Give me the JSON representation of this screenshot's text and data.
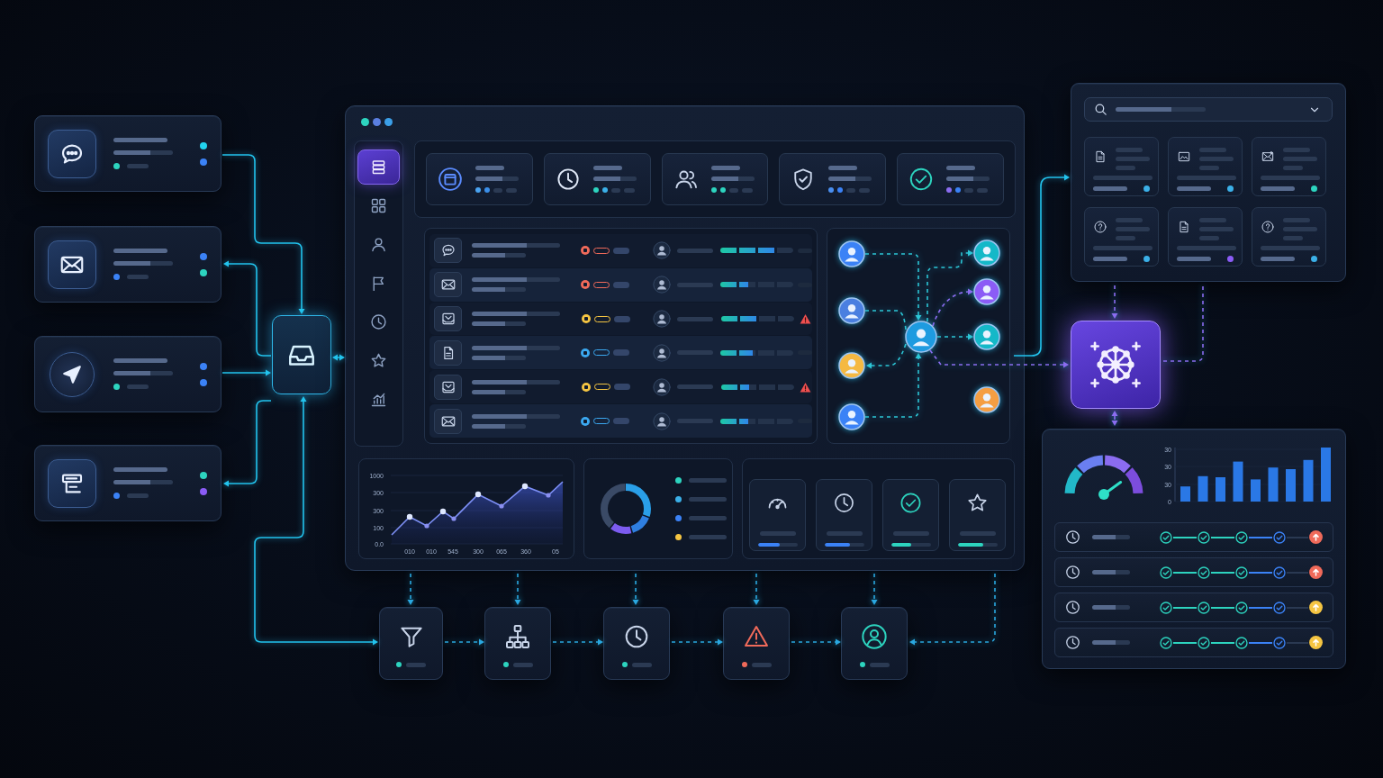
{
  "sources": [
    {
      "kind": "chat",
      "color": "#2dd4bf",
      "markers": [
        {
          "color": "#22d3ee"
        },
        {
          "color": "#3b82f6"
        }
      ]
    },
    {
      "kind": "mail",
      "color": "#3b82f6",
      "markers": [
        {
          "color": "#3b82f6"
        },
        {
          "color": "#2dd4bf"
        }
      ]
    },
    {
      "kind": "send",
      "color": "#2dd4bf",
      "markers": [
        {
          "color": "#3b82f6"
        },
        {
          "color": "#3b82f6"
        }
      ]
    },
    {
      "kind": "form",
      "color": "#3b82f6",
      "markers": [
        {
          "color": "#2dd4bf"
        },
        {
          "color": "#8b5cf6"
        }
      ]
    }
  ],
  "window": {
    "dots": [
      {
        "color": "#2dd4bf"
      },
      {
        "color": "#5b7fe0"
      },
      {
        "color": "#3b9fe8"
      }
    ]
  },
  "sidebar": {
    "items": [
      {
        "kind": "list",
        "selected": true
      },
      {
        "kind": "grid",
        "selected": false
      },
      {
        "kind": "user",
        "selected": false
      },
      {
        "kind": "flag",
        "selected": false
      },
      {
        "kind": "clock",
        "selected": false
      },
      {
        "kind": "star",
        "selected": false
      },
      {
        "kind": "chart",
        "selected": false
      }
    ]
  },
  "stat_cards": [
    {
      "kind": "calendar",
      "markers": [
        {
          "color": "#4aa3f0"
        },
        {
          "color": "#3b8fe8"
        }
      ]
    },
    {
      "kind": "clock",
      "markers": [
        {
          "color": "#2dd4bf"
        },
        {
          "color": "#3bb0e8"
        }
      ]
    },
    {
      "kind": "users",
      "markers": [
        {
          "color": "#2dd4bf"
        },
        {
          "color": "#2dd4bf"
        }
      ]
    },
    {
      "kind": "shield",
      "markers": [
        {
          "color": "#4a8ff0"
        },
        {
          "color": "#3b82f6"
        }
      ]
    },
    {
      "kind": "check",
      "markers": [
        {
          "color": "#8b6cf0"
        },
        {
          "color": "#3b82f6"
        }
      ]
    }
  ],
  "table": {
    "rows": [
      {
        "kind": "chat",
        "color": "#f06a5a",
        "level": 0.75,
        "alert": false
      },
      {
        "kind": "mail",
        "color": "#f06a5a",
        "level": 0.38,
        "alert": false
      },
      {
        "kind": "inbox",
        "color": "#f5c542",
        "level": 0.5,
        "alert": true
      },
      {
        "kind": "document",
        "color": "#3ba8f0",
        "level": 0.45,
        "alert": false
      },
      {
        "kind": "inbox",
        "color": "#f5c542",
        "level": 0.38,
        "alert": true
      },
      {
        "kind": "mail",
        "color": "#3ba8f0",
        "level": 0.38,
        "alert": false
      }
    ]
  },
  "network": {
    "center": {
      "color": "#1e9be0"
    },
    "left": [
      {
        "color": "#3b82f6"
      },
      {
        "color": "#4a7fe0"
      },
      {
        "color": "#f5b942"
      },
      {
        "color": "#3b82f6"
      }
    ],
    "right": [
      {
        "color": "#14b8c8"
      },
      {
        "color": "#8b5cf6"
      },
      {
        "color": "#14b8c8"
      },
      {
        "color": "#f59e42"
      }
    ]
  },
  "line_chart": {
    "y_labels": [
      "1000",
      "300",
      "300",
      "100",
      "0.0"
    ],
    "x_labels": [
      "010",
      "010",
      "545",
      "300",
      "065",
      "360",
      "05"
    ]
  },
  "donut": {
    "legend": [
      {
        "color": "#2dd4bf"
      },
      {
        "color": "#3bb0e8"
      },
      {
        "color": "#3b82f6"
      },
      {
        "color": "#f5c542"
      }
    ]
  },
  "metrics": [
    {
      "kind": "gauge",
      "color": "#3b82f6",
      "level": 0.55
    },
    {
      "kind": "clock",
      "color": "#3b82f6",
      "level": 0.65
    },
    {
      "kind": "check",
      "color": "#2dd4bf",
      "level": 0.5
    },
    {
      "kind": "star",
      "color": "#2dd4bf",
      "level": 0.65
    }
  ],
  "workflow": [
    {
      "kind": "filter",
      "color": "#2dd4bf"
    },
    {
      "kind": "hierarchy",
      "color": "#2dd4bf"
    },
    {
      "kind": "clock",
      "color": "#2dd4bf"
    },
    {
      "kind": "warning",
      "color": "#f06a5a"
    },
    {
      "kind": "user",
      "color": "#2dd4bf"
    }
  ],
  "library": {
    "files": [
      {
        "kind": "document",
        "color": "#3bb0e8"
      },
      {
        "kind": "image",
        "color": "#3bb0e8"
      },
      {
        "kind": "mail_image",
        "color": "#2dd4bf"
      },
      {
        "kind": "question",
        "color": "#3bb0e8"
      },
      {
        "kind": "document",
        "color": "#8b5cf6"
      },
      {
        "kind": "question",
        "color": "#3bb0e8"
      }
    ]
  },
  "monitor": {
    "bar_chart": {
      "y_labels": [
        "30",
        "30",
        "30",
        "0"
      ]
    },
    "rows": [
      {
        "steps": [
          {
            "color": "#2dd4bf"
          },
          {
            "color": "#2dd4bf"
          },
          {
            "color": "#2dd4bf"
          },
          {
            "color": "#3b82f6"
          }
        ],
        "color": "#f06a5a"
      },
      {
        "steps": [
          {
            "color": "#2dd4bf"
          },
          {
            "color": "#2dd4bf"
          },
          {
            "color": "#2dd4bf"
          },
          {
            "color": "#3b82f6"
          }
        ],
        "color": "#f06a5a"
      },
      {
        "steps": [
          {
            "color": "#2dd4bf"
          },
          {
            "color": "#2dd4bf"
          },
          {
            "color": "#2dd4bf"
          },
          {
            "color": "#3b82f6"
          }
        ],
        "color": "#f5c542"
      },
      {
        "steps": [
          {
            "color": "#2dd4bf"
          },
          {
            "color": "#2dd4bf"
          },
          {
            "color": "#2dd4bf"
          },
          {
            "color": "#3b82f6"
          }
        ],
        "color": "#f5c542"
      }
    ]
  }
}
